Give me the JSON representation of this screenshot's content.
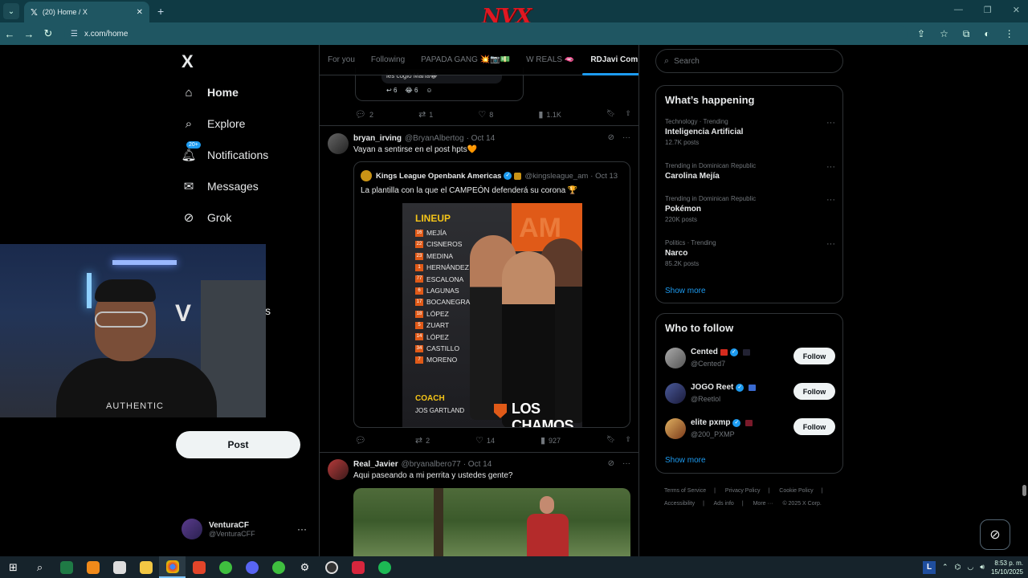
{
  "browser": {
    "tab_title": "(20) Home / X",
    "url": "x.com/home",
    "brand_logo": "NVX"
  },
  "nav": {
    "brand": "X",
    "items": [
      {
        "label": "Home",
        "icon": "home-icon"
      },
      {
        "label": "Explore",
        "icon": "search-icon"
      },
      {
        "label": "Notifications",
        "icon": "bell-icon",
        "badge": "20+"
      },
      {
        "label": "Messages",
        "icon": "mail-icon"
      },
      {
        "label": "Grok",
        "icon": "grok-icon"
      },
      {
        "label": "s",
        "icon": "more-icon"
      }
    ],
    "post_label": "Post",
    "account": {
      "name": "VenturaCF",
      "handle": "@VenturaCFF"
    }
  },
  "webcam": {
    "shirt_text": "AUTHENTIC",
    "wall_letter": "V"
  },
  "timeline": {
    "tabs": [
      "For you",
      "Following",
      "PAPADA GANG 💥📷💵",
      "W REALS 🫦",
      "RDJavi Com"
    ],
    "active_tab": 4,
    "prev_reply": {
      "text": "les cogió María😂",
      "reply_count": "6",
      "react_count": "6"
    },
    "prev_actions": {
      "replies": "2",
      "reposts": "1",
      "likes": "8",
      "views": "1.1K"
    },
    "tweets": [
      {
        "name": "bryan_irving",
        "handle": "@BryanAlbertog",
        "date": "· Oct 14",
        "text": "Vayan a sentirse en el post hpts🧡",
        "quote": {
          "name": "Kings League Openbank Americas",
          "handle": "@kingsleague_am",
          "date": "· Oct 13",
          "text": "La plantilla con la que el CAMPEÓN defenderá su corona 🏆",
          "poster": {
            "title": "LINEUP",
            "players": [
              {
                "num": "16",
                "name": "MEJÍA"
              },
              {
                "num": "22",
                "name": "CISNEROS"
              },
              {
                "num": "23",
                "name": "MEDINA"
              },
              {
                "num": "1",
                "name": "HERNÁNDEZ"
              },
              {
                "num": "77",
                "name": "ESCALONA"
              },
              {
                "num": "6",
                "name": "LAGUNAS"
              },
              {
                "num": "17",
                "name": "BOCANEGRA"
              },
              {
                "num": "18",
                "name": "LÓPEZ"
              },
              {
                "num": "5",
                "name": "ZUART"
              },
              {
                "num": "14",
                "name": "LÓPEZ"
              },
              {
                "num": "34",
                "name": "CASTILLO"
              },
              {
                "num": "7",
                "name": "MORENO"
              }
            ],
            "coach_title": "COACH",
            "coach_name": "JOS GARTLAND",
            "team": "LOS CHAMOS",
            "corner": "AM"
          }
        },
        "actions": {
          "replies": "",
          "reposts": "2",
          "likes": "14",
          "views": "927"
        }
      },
      {
        "name": "Real_Javier",
        "handle": "@bryanalbero77",
        "date": "· Oct 14",
        "text": "Aqui paseando a mi perrita y ustedes gente?"
      }
    ]
  },
  "sidebar": {
    "search_placeholder": "Search",
    "happening": {
      "title": "What’s happening",
      "trends": [
        {
          "category": "Technology · Trending",
          "name": "Inteligencia Artificial",
          "count": "12.7K posts"
        },
        {
          "category": "Trending in Dominican Republic",
          "name": "Carolina Mejía",
          "count": ""
        },
        {
          "category": "Trending in Dominican Republic",
          "name": "Pokémon",
          "count": "220K posts"
        },
        {
          "category": "Politics · Trending",
          "name": "Narco",
          "count": "85.2K posts"
        }
      ],
      "show_more": "Show more"
    },
    "who_to_follow": {
      "title": "Who to follow",
      "accounts": [
        {
          "name": "Cented",
          "handle": "@Cented7",
          "button": "Follow"
        },
        {
          "name": "JOGO Reet",
          "handle": "@Reetlol",
          "button": "Follow"
        },
        {
          "name": "elite pxmp",
          "handle": "@200_PXMP",
          "button": "Follow"
        }
      ],
      "show_more": "Show more"
    },
    "footer": [
      "Terms of Service",
      "|",
      "Privacy Policy",
      "|",
      "Cookie Policy",
      "|",
      "Accessibility",
      "|",
      "Ads info",
      "|",
      "More ···",
      "© 2025 X Corp."
    ]
  },
  "taskbar": {
    "lang": "L",
    "time": "8:53 p. m.",
    "date": "15/10/2025"
  },
  "colors": {
    "accent": "#1d9bf0",
    "background": "#000000",
    "chrome": "#1f5662",
    "brand_red": "#e01822"
  }
}
